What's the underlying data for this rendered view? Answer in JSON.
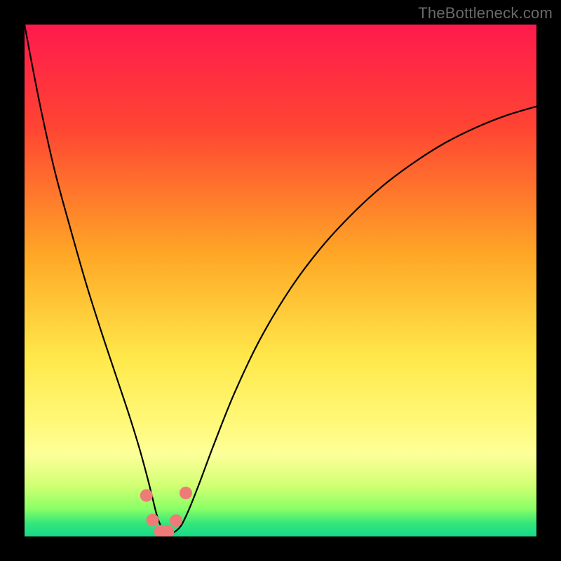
{
  "watermark": "TheBottleneck.com",
  "chart_data": {
    "type": "line",
    "title": "",
    "xlabel": "",
    "ylabel": "",
    "xlim": [
      0,
      100
    ],
    "ylim": [
      0,
      100
    ],
    "gradient_stops": [
      {
        "offset": 0,
        "color": "#ff1a4d"
      },
      {
        "offset": 0.2,
        "color": "#ff4433"
      },
      {
        "offset": 0.45,
        "color": "#ffa726"
      },
      {
        "offset": 0.65,
        "color": "#ffe84a"
      },
      {
        "offset": 0.78,
        "color": "#fff97a"
      },
      {
        "offset": 0.84,
        "color": "#fdff99"
      },
      {
        "offset": 0.9,
        "color": "#d2ff73"
      },
      {
        "offset": 0.945,
        "color": "#8cff66"
      },
      {
        "offset": 0.975,
        "color": "#33e67a"
      },
      {
        "offset": 1.0,
        "color": "#17d98a"
      }
    ],
    "series": [
      {
        "name": "curve",
        "x": [
          0.0,
          1.5,
          3.5,
          6.0,
          9.0,
          12.0,
          15.0,
          18.0,
          20.5,
          22.5,
          24.0,
          25.0,
          25.8,
          26.5,
          27.2,
          28.0,
          29.0,
          30.5,
          32.0,
          34.0,
          37.0,
          41.0,
          46.0,
          52.0,
          58.0,
          64.0,
          70.0,
          76.0,
          82.0,
          88.0,
          94.0,
          100.0
        ],
        "y": [
          100.0,
          92.0,
          82.0,
          71.0,
          60.0,
          49.5,
          40.0,
          31.0,
          23.5,
          17.0,
          11.5,
          7.5,
          4.3,
          2.3,
          1.1,
          0.5,
          0.7,
          2.0,
          5.0,
          10.0,
          18.0,
          28.0,
          38.5,
          48.5,
          56.5,
          63.0,
          68.5,
          73.0,
          76.8,
          79.8,
          82.2,
          84.0
        ]
      }
    ],
    "markers": {
      "name": "highlight-dots",
      "color": "#ef7b78",
      "radius": 9,
      "points": [
        {
          "x": 23.8,
          "y": 8.0
        },
        {
          "x": 25.0,
          "y": 3.2
        },
        {
          "x": 26.5,
          "y": 1.0
        },
        {
          "x": 28.0,
          "y": 1.0
        },
        {
          "x": 29.6,
          "y": 3.1
        },
        {
          "x": 31.5,
          "y": 8.5
        }
      ]
    }
  }
}
